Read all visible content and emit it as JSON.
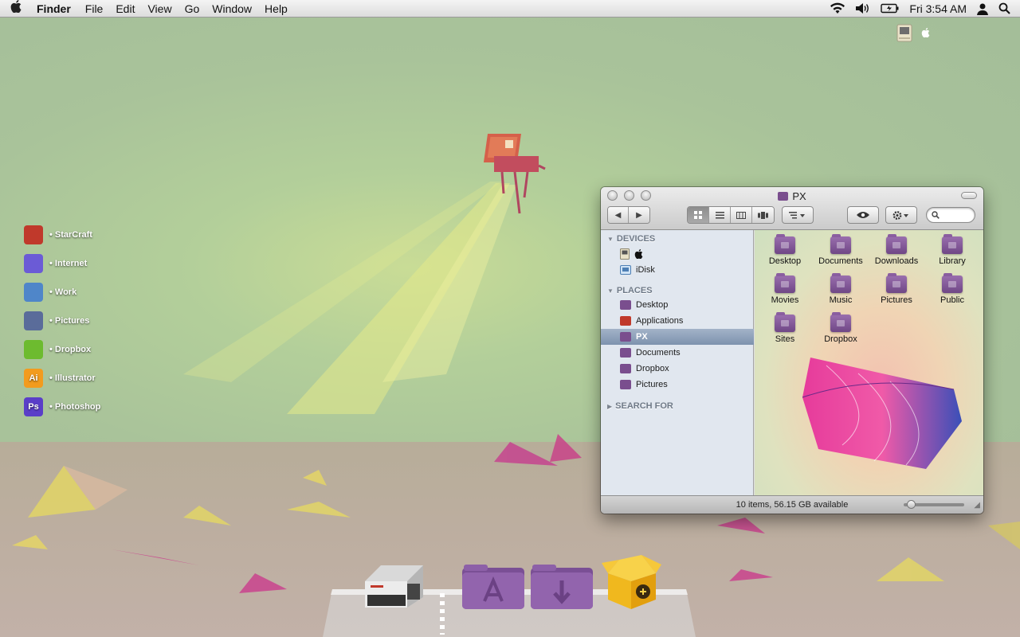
{
  "menubar": {
    "app_name": "Finder",
    "menus": [
      "File",
      "Edit",
      "View",
      "Go",
      "Window",
      "Help"
    ],
    "clock": "Fri 3:54 AM",
    "status_icons": [
      "wifi-icon",
      "volume-icon",
      "battery-icon",
      "user-icon",
      "spotlight-icon"
    ]
  },
  "desktop": {
    "shortcuts": [
      {
        "label": "• StarCraft",
        "icon": "starcraft-icon",
        "color": "#c0392b"
      },
      {
        "label": "• Internet",
        "icon": "globe-icon",
        "color": "#6b5bd6"
      },
      {
        "label": "• Work",
        "icon": "work-icon",
        "color": "#4f86c9"
      },
      {
        "label": "• Pictures",
        "icon": "pictures-icon",
        "color": "#5a6c9a"
      },
      {
        "label": "• Dropbox",
        "icon": "dropbox-icon",
        "color": "#6dbb2f"
      },
      {
        "label": "• Illustrator",
        "icon": "illustrator-icon",
        "glyph": "Ai",
        "color": "#f29b1e"
      },
      {
        "label": "• Photoshop",
        "icon": "photoshop-icon",
        "glyph": "Ps",
        "color": "#5a3ec8"
      }
    ]
  },
  "finder": {
    "title": "PX",
    "sidebar": {
      "devices_header": "DEVICES",
      "devices": [
        {
          "label": "",
          "icon": "apple-icon"
        },
        {
          "label": "iDisk",
          "icon": "idisk-icon"
        }
      ],
      "places_header": "PLACES",
      "places": [
        {
          "label": "Desktop",
          "icon": "desktop-folder-icon",
          "selected": false
        },
        {
          "label": "Applications",
          "icon": "applications-icon",
          "selected": false
        },
        {
          "label": "PX",
          "icon": "home-icon",
          "selected": true
        },
        {
          "label": "Documents",
          "icon": "documents-folder-icon",
          "selected": false
        },
        {
          "label": "Dropbox",
          "icon": "dropbox-folder-icon",
          "selected": false
        },
        {
          "label": "Pictures",
          "icon": "pictures-folder-icon",
          "selected": false
        }
      ],
      "search_header": "SEARCH FOR"
    },
    "items": [
      {
        "label": "Desktop"
      },
      {
        "label": "Documents"
      },
      {
        "label": "Downloads"
      },
      {
        "label": "Library"
      },
      {
        "label": "Movies"
      },
      {
        "label": "Music"
      },
      {
        "label": "Pictures"
      },
      {
        "label": "Public"
      },
      {
        "label": "Sites"
      },
      {
        "label": "Dropbox"
      }
    ],
    "status": "10 items, 56.15 GB available",
    "zoom_level": 0.05
  },
  "dock": {
    "items": [
      "nes-console-icon",
      "applications-stack-icon",
      "downloads-stack-icon",
      "package-box-icon"
    ]
  }
}
